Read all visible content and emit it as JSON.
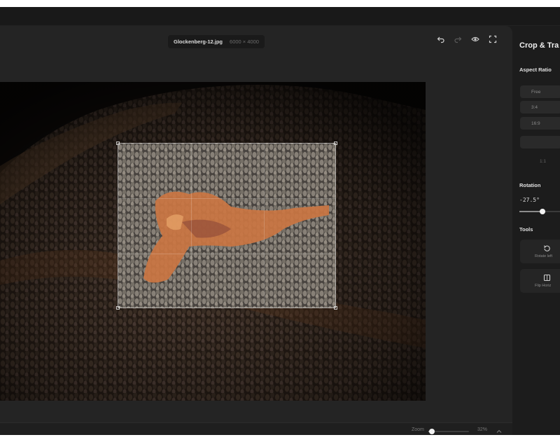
{
  "editor": {
    "file_name": "Glockenberg-12.jpg",
    "file_dims": "6000 × 4000",
    "toolbar_icons": [
      "undo-icon",
      "redo-icon",
      "eye-icon",
      "fullscreen-icon"
    ]
  },
  "zoom": {
    "label": "Zoom",
    "value_text": "32%",
    "level_fraction": 0.08
  },
  "panel": {
    "title": "Crop & Tra",
    "aspect_ratio": {
      "label": "Aspect Ratio",
      "options": [
        "Free",
        "3:4",
        "16:9"
      ],
      "extra_option": "1:1"
    },
    "rotation": {
      "label": "Rotation",
      "value_text": "-27.5°",
      "level_fraction": 0.55
    },
    "tools": {
      "label": "Tools",
      "items": [
        {
          "label": "Rotate left",
          "icon": "rotate-left-icon"
        },
        {
          "label": "Flip Horiz",
          "icon": "flip-icon"
        }
      ]
    }
  },
  "colors": {
    "app_bg": "#1c1c1c",
    "workspace_bg": "#242424",
    "accent_orange": "#c76a33"
  }
}
